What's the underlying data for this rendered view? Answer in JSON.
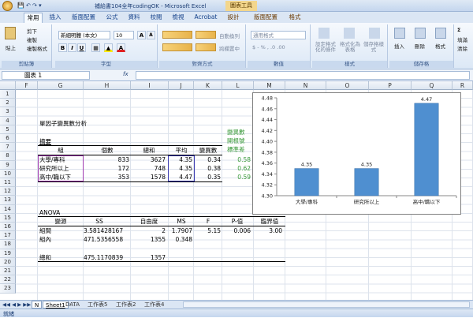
{
  "window": {
    "title": "補給書104全年codingOK - Microsoft Excel",
    "context_tab_title": "圖表工具"
  },
  "ribbon_tabs": [
    "常用",
    "插入",
    "版面配置",
    "公式",
    "資料",
    "校閱",
    "檢視",
    "Acrobat",
    "設計",
    "版面配置",
    "格式"
  ],
  "ribbon": {
    "clipboard": {
      "paste": "貼上",
      "cut": "剪下",
      "copy": "複製",
      "format_painter": "複製格式",
      "label": "剪貼簿"
    },
    "font": {
      "family": "新細明體 (本文)",
      "size": "10",
      "label": "字型"
    },
    "alignment": {
      "wrap": "自動換列",
      "merge": "跨欄置中",
      "label": "對齊方式"
    },
    "number": {
      "format": "通用格式",
      "label": "數值"
    },
    "styles": {
      "conditional": "設定格式化的條件",
      "table": "格式化為表格",
      "cell": "儲存格樣式",
      "label": "樣式"
    },
    "cells": {
      "insert": "插入",
      "delete": "刪除",
      "format": "格式",
      "label": "儲存格"
    },
    "editing": {
      "fill": "填滿",
      "clear": "清除"
    }
  },
  "formula_bar": {
    "name_box": "圖表 1",
    "fx": "fx",
    "content": ""
  },
  "columns": [
    "F",
    "G",
    "H",
    "I",
    "J",
    "K",
    "L",
    "M",
    "N",
    "O",
    "P",
    "Q",
    "R"
  ],
  "rows": [
    "1",
    "2",
    "3",
    "4",
    "5",
    "6",
    "7",
    "8",
    "9",
    "10",
    "11",
    "12",
    "13",
    "14",
    "15",
    "16",
    "17",
    "18",
    "19",
    "20",
    "21",
    "22",
    "23"
  ],
  "sheet": {
    "title": "單因子變異數分析",
    "summary_label": "摘要",
    "side_label": [
      "變異數",
      "開根號",
      "標準差"
    ],
    "summary_headers": [
      "組",
      "個數",
      "總和",
      "平均",
      "變異數"
    ],
    "summary_rows": [
      {
        "group": "大學/專科",
        "count": "833",
        "sum": "3627",
        "mean": "4.35",
        "var": "0.34",
        "sd": "0.58"
      },
      {
        "group": "研究所以上",
        "count": "172",
        "sum": "748",
        "mean": "4.35",
        "var": "0.38",
        "sd": "0.62"
      },
      {
        "group": "高中/職以下",
        "count": "353",
        "sum": "1578",
        "mean": "4.47",
        "var": "0.35",
        "sd": "0.59"
      }
    ],
    "anova_label": "ANOVA",
    "anova_headers": [
      "變源",
      "SS",
      "自由度",
      "MS",
      "F",
      "P-值",
      "臨界值"
    ],
    "anova_rows": [
      {
        "src": "組間",
        "ss": "3.581428167",
        "df": "2",
        "ms": "1.7907",
        "f": "5.15",
        "p": "0.006",
        "crit": "3.00"
      },
      {
        "src": "組內",
        "ss": "471.5356558",
        "df": "1355",
        "ms": "0.348",
        "f": "",
        "p": "",
        "crit": ""
      },
      {
        "src": "總和",
        "ss": "475.1170839",
        "df": "1357",
        "ms": "",
        "f": "",
        "p": "",
        "crit": ""
      }
    ]
  },
  "chart_data": {
    "type": "bar",
    "categories": [
      "大學/專科",
      "研究所以上",
      "高中/職以下"
    ],
    "values": [
      4.35,
      4.35,
      4.47
    ],
    "data_labels": [
      "4.35",
      "4.35",
      "4.47"
    ],
    "ylim": [
      4.3,
      4.48
    ],
    "yticks": [
      "4.30",
      "4.32",
      "4.34",
      "4.36",
      "4.38",
      "4.40",
      "4.42",
      "4.44",
      "4.46",
      "4.48"
    ],
    "bar_color": "#4f8fd0",
    "grid": false
  },
  "sheet_tabs": [
    "N",
    "Sheet1",
    "DATA",
    "工作表5",
    "工作表2",
    "工作表4"
  ],
  "status": {
    "mode": "就緒"
  }
}
